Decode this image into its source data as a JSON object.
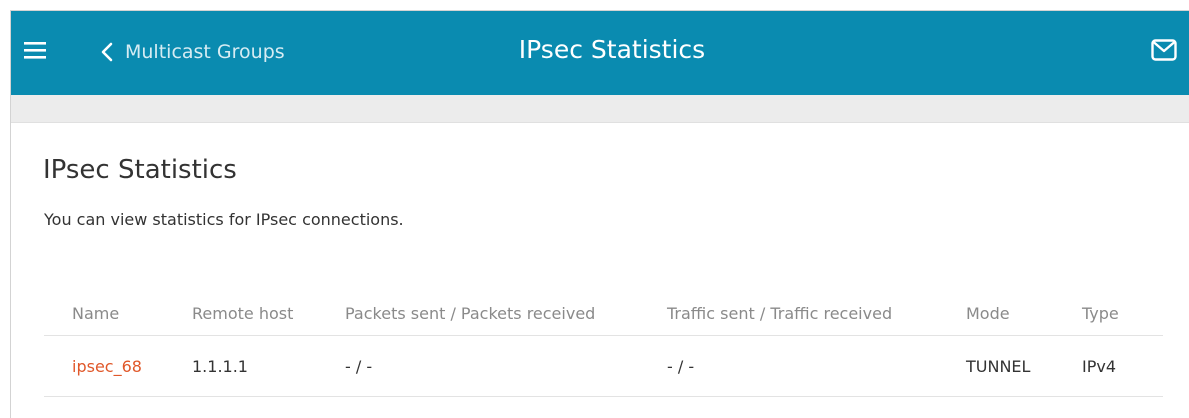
{
  "header": {
    "back_label": "Multicast Groups",
    "title": "IPsec Statistics",
    "bg_color": "#0a8bb0",
    "icons": {
      "menu": "menu-icon",
      "back": "chevron-left-icon",
      "messages": "mail-icon"
    }
  },
  "section": {
    "title": "IPsec Statistics",
    "description": "You can view statistics for IPsec connections."
  },
  "table": {
    "columns": [
      "Name",
      "Remote host",
      "Packets sent / Packets received",
      "Traffic sent / Traffic received",
      "Mode",
      "Type"
    ],
    "rows": [
      {
        "name": "ipsec_68",
        "remote_host": "1.1.1.1",
        "packets": "- / -",
        "traffic": "- / -",
        "mode": "TUNNEL",
        "type": "IPv4"
      }
    ],
    "link_color": "#e0582a"
  }
}
